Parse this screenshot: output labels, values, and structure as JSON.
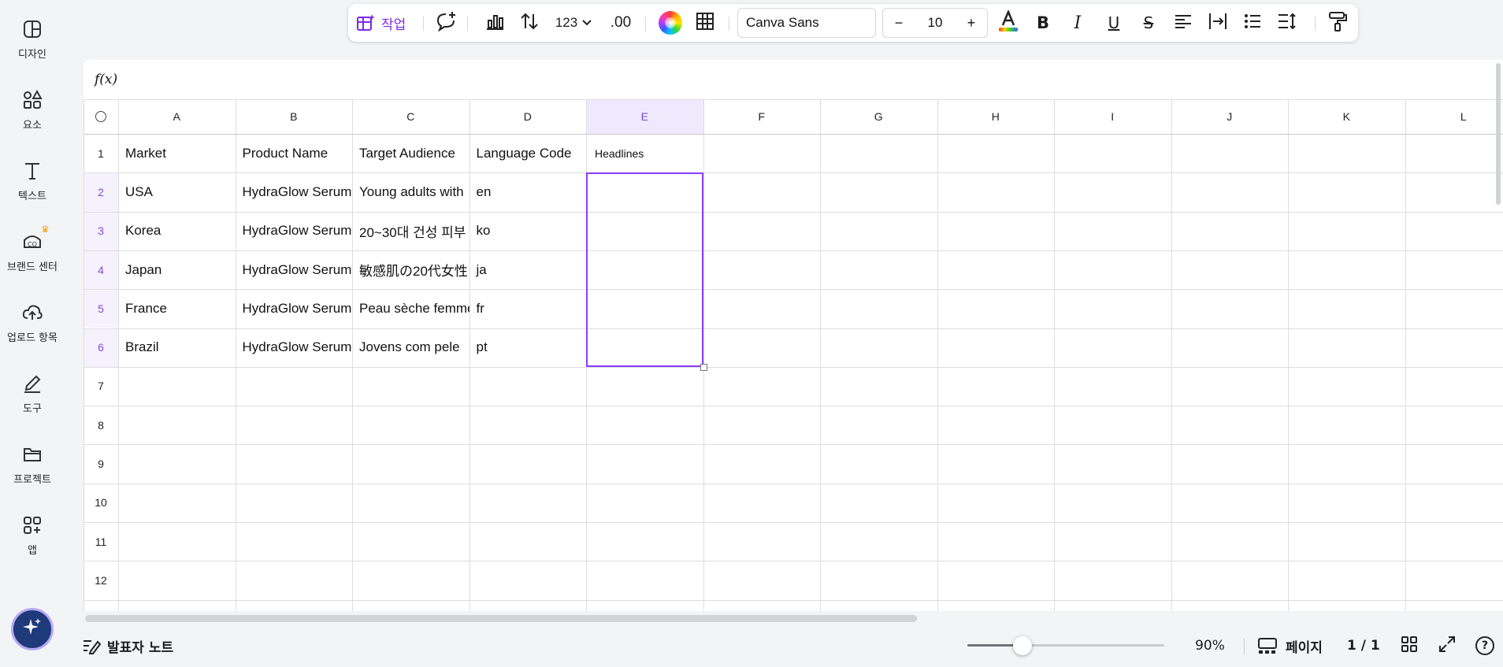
{
  "sidebar": {
    "items": [
      {
        "label": "디자인",
        "icon": "design-icon"
      },
      {
        "label": "요소",
        "icon": "elements-icon"
      },
      {
        "label": "텍스트",
        "icon": "text-icon"
      },
      {
        "label": "브랜드 센터",
        "icon": "brand-icon"
      },
      {
        "label": "업로드 항목",
        "icon": "upload-icon"
      },
      {
        "label": "도구",
        "icon": "tools-icon"
      },
      {
        "label": "프로젝트",
        "icon": "folder-icon"
      },
      {
        "label": "앱",
        "icon": "apps-icon"
      }
    ]
  },
  "toolbar": {
    "actions_label": "작업",
    "number_format_label": "123",
    "decimal_label": ".00",
    "font_name": "Canva Sans",
    "font_size": "10",
    "minus": "−",
    "plus": "+",
    "accent": "#7d2ae8"
  },
  "formula_bar": {
    "label": "f(x)"
  },
  "sheet": {
    "columns": [
      "A",
      "B",
      "C",
      "D",
      "E",
      "F",
      "G",
      "H",
      "I",
      "J",
      "K",
      "L"
    ],
    "rows": [
      "1",
      "2",
      "3",
      "4",
      "5",
      "6",
      "7",
      "8",
      "9",
      "10",
      "11",
      "12"
    ],
    "cells": [
      [
        "Market",
        "Product Name",
        "Target Audience",
        "Language Code",
        "Headlines"
      ],
      [
        "USA",
        "HydraGlow Serum",
        "Young adults with",
        "en",
        ""
      ],
      [
        "Korea",
        "HydraGlow Serum",
        "20~30대 건성 피부",
        "ko",
        ""
      ],
      [
        "Japan",
        "HydraGlow Serum",
        "敏感肌の20代女性",
        "ja",
        ""
      ],
      [
        "France",
        "HydraGlow Serum",
        "Peau sèche femme",
        "fr",
        ""
      ],
      [
        "Brazil",
        "HydraGlow Serum",
        "Jovens com pele",
        "pt",
        ""
      ]
    ],
    "selected_column": "E",
    "selected_rows": [
      "2",
      "3",
      "4",
      "5",
      "6"
    ],
    "selection_color": "#8b3dff"
  },
  "bottombar": {
    "notes_label": "발표자 노트",
    "zoom_label": "90%",
    "zoom_fraction": 0.28,
    "pages_label": "페이지",
    "page_count": "1 / 1"
  }
}
